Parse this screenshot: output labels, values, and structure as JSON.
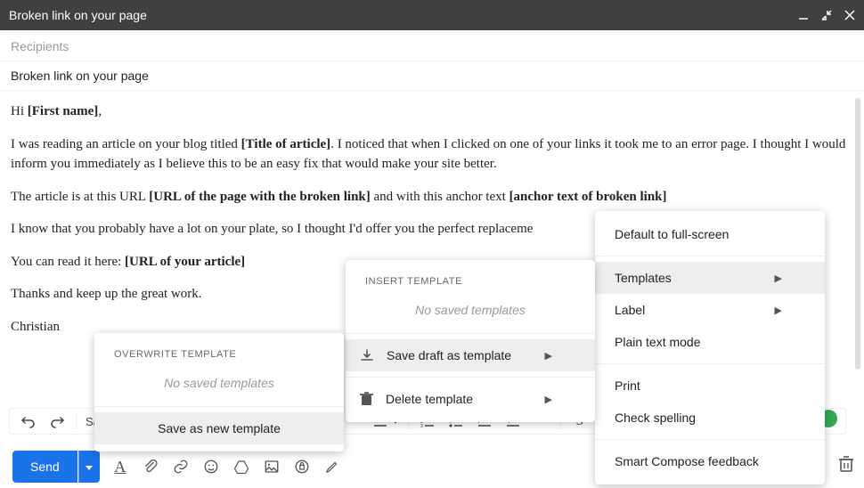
{
  "titlebar": {
    "title": "Broken link on your page"
  },
  "recipients": {
    "placeholder": "Recipients"
  },
  "subject": {
    "value": "Broken link on your page"
  },
  "body": {
    "greeting_pre": "Hi ",
    "greeting_ph": "[First name]",
    "greeting_post": ",",
    "p1_a": "I was reading an article on your blog titled ",
    "p1_b": "[Title of article]",
    "p1_c": ". I noticed that when I clicked on one of your links it took me to an error page. I thought I would inform you immediately as I believe this to be an easy fix that would make your site better.",
    "p2_a": "The article is at this URL ",
    "p2_b": "[URL of the page with the broken link]",
    "p2_c": " and with this anchor text ",
    "p2_d": "[anchor text of broken link]",
    "p3": "I know that you probably have a lot on your plate, so I thought I'd offer you the perfect replaceme",
    "p4_a": "You can read it here: ",
    "p4_b": "[URL of your article]",
    "p5": "Thanks and keep up the great work.",
    "signoff": "Christian"
  },
  "format": {
    "sans": "Sa",
    "undo": "↶",
    "redo": "↷"
  },
  "send": {
    "label": "Send"
  },
  "more_menu": {
    "default_fullscreen": "Default to full-screen",
    "templates": "Templates",
    "label": "Label",
    "plaintext": "Plain text mode",
    "print": "Print",
    "spelling": "Check spelling",
    "smart_compose": "Smart Compose feedback"
  },
  "templates_menu": {
    "header": "INSERT TEMPLATE",
    "no_saved": "No saved templates",
    "save_draft": "Save draft as template",
    "delete": "Delete template"
  },
  "save_menu": {
    "header": "OVERWRITE TEMPLATE",
    "no_saved": "No saved templates",
    "save_new": "Save as new template"
  }
}
